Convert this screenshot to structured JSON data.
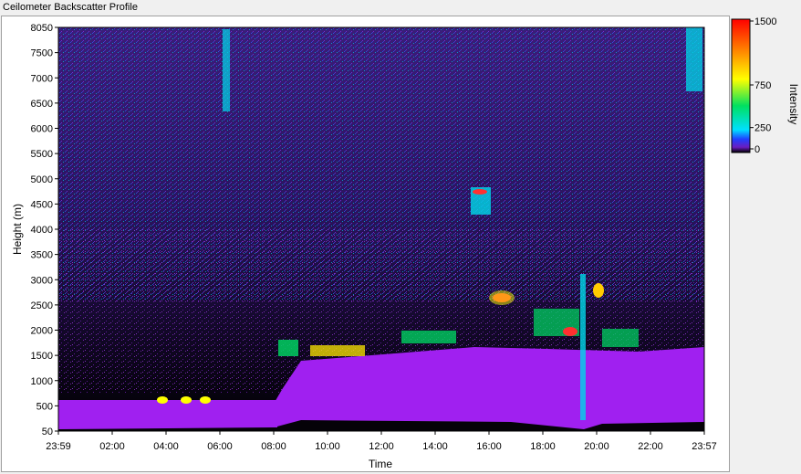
{
  "window": {
    "title": "Ceilometer Backscatter Profile"
  },
  "chart_data": {
    "type": "heatmap",
    "title": "",
    "xlabel": "Time",
    "ylabel": "Height (m)",
    "x_ticks": [
      "23:59",
      "02:00",
      "04:00",
      "06:00",
      "08:00",
      "10:00",
      "12:00",
      "14:00",
      "16:00",
      "18:00",
      "20:00",
      "22:00",
      "23:57"
    ],
    "y_ticks": [
      "50",
      "500",
      "1000",
      "1500",
      "2000",
      "2500",
      "3000",
      "3500",
      "4000",
      "4500",
      "5000",
      "5500",
      "6000",
      "6500",
      "7000",
      "7500",
      "8050"
    ],
    "ylim": [
      50,
      8050
    ],
    "colorbar": {
      "label": "Intensity",
      "ticks": [
        "0",
        "250",
        "750",
        "1500"
      ],
      "range": [
        0,
        1500
      ]
    },
    "colors": {
      "background": "#000000",
      "noise_low": "#6a1cc0",
      "aerosol_layer": "#a020f0",
      "mid": "#00c8ff",
      "high": "#ffff00",
      "max": "#ff0000"
    }
  }
}
